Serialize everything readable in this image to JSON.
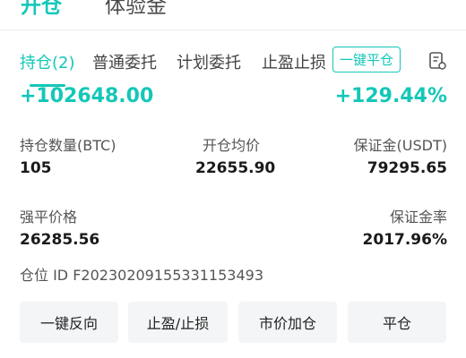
{
  "top_tabs": {
    "open": "开仓",
    "trial": "体验金"
  },
  "sub_tabs": {
    "positions": "持仓(2)",
    "normal_orders": "普通委托",
    "plan_orders": "计划委托",
    "tp_sl": "止盈止损"
  },
  "one_click_close": "一键平仓",
  "icons": {
    "records": "document-list-icon"
  },
  "position": {
    "pnl": "+102648.00",
    "pnl_rate": "+129.44%",
    "qty_label": "持仓数量(BTC)",
    "qty_value": "105",
    "avg_price_label": "开仓均价",
    "avg_price_value": "22655.90",
    "margin_label": "保证金(USDT)",
    "margin_value": "79295.65",
    "liq_label": "强平价格",
    "liq_value": "26285.56",
    "margin_rate_label": "保证金率",
    "margin_rate_value": "2017.96%",
    "id_text": "仓位 ID F20230209155331153493"
  },
  "actions": {
    "reverse": "一键反向",
    "tpsl": "止盈/止损",
    "add_market": "市价加仓",
    "close": "平仓"
  },
  "colors": {
    "accent": "#14c7b8",
    "button_bg": "#f4f5f7"
  }
}
